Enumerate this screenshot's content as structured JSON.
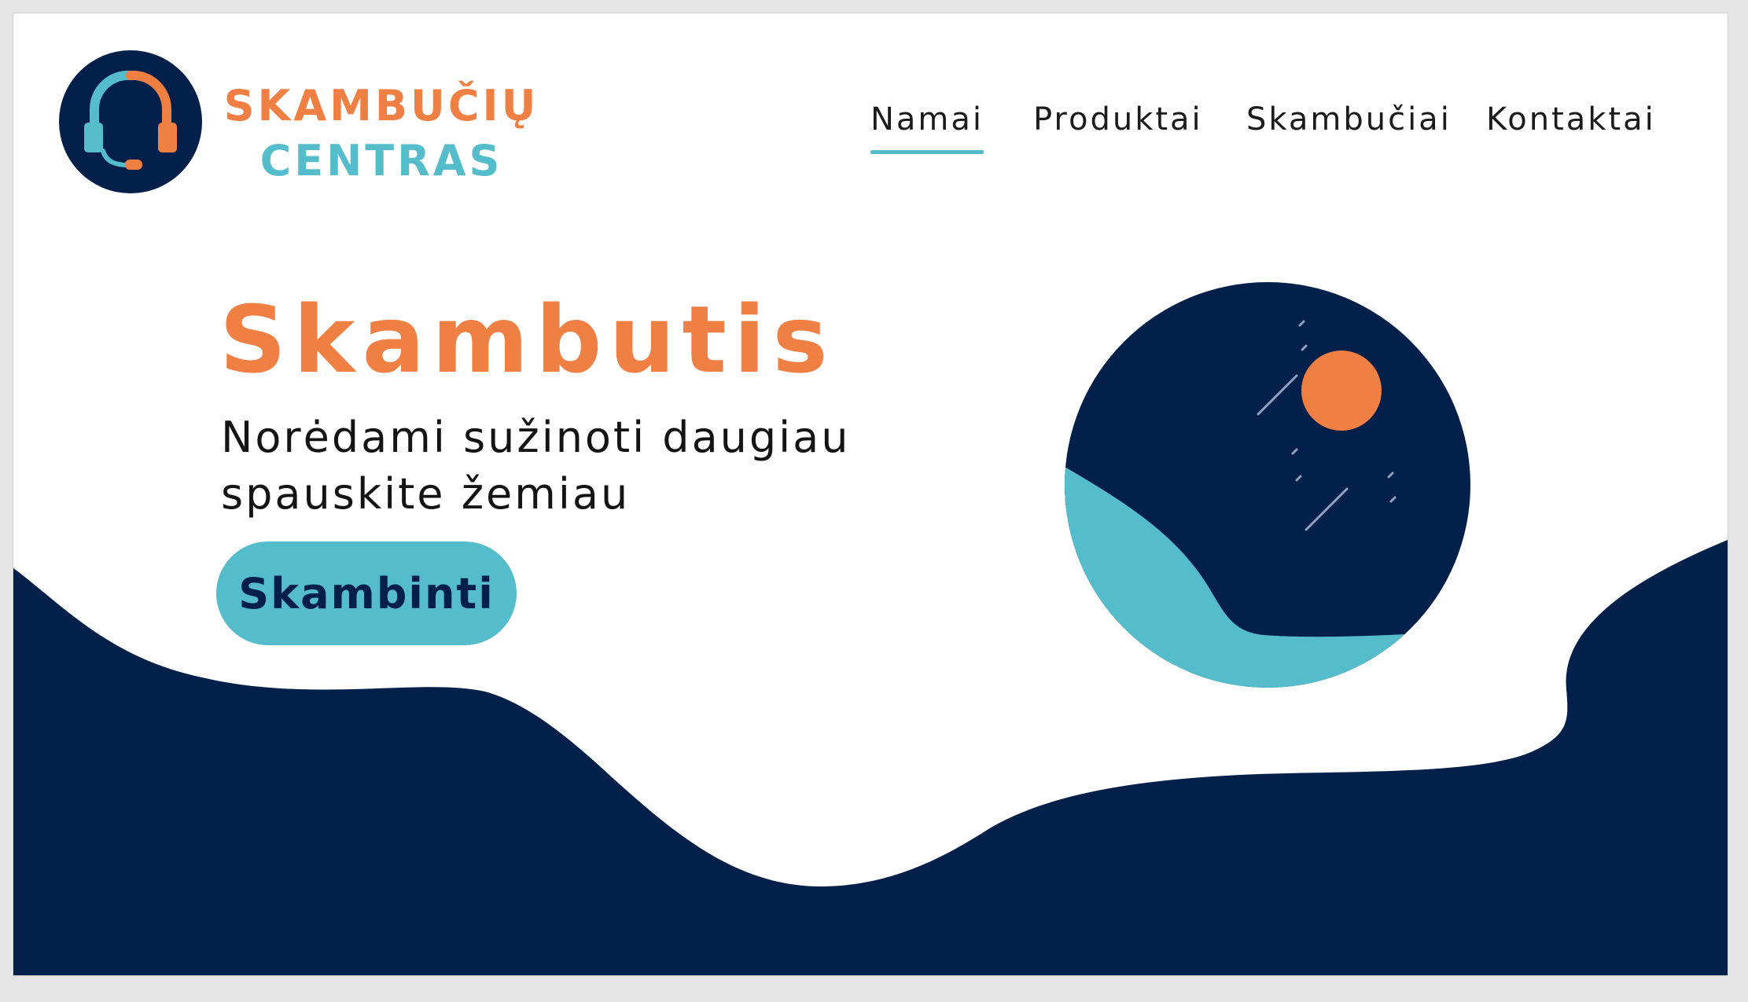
{
  "colors": {
    "navy": "#03204A",
    "orange": "#F07F43",
    "teal": "#55BCCB",
    "white": "#FFFFFF",
    "text_dark": "#141414"
  },
  "brand": {
    "line1": "SKAMBUČIŲ",
    "line2": "CENTRAS",
    "icon": "headset-icon"
  },
  "nav": {
    "items": [
      {
        "label": "Namai",
        "active": true
      },
      {
        "label": "Produktai",
        "active": false
      },
      {
        "label": "Skambučiai",
        "active": false
      },
      {
        "label": "Kontaktai",
        "active": false
      }
    ]
  },
  "hero": {
    "title": "Skambutis",
    "subtitle_line1": "Norėdami sužinoti daugiau",
    "subtitle_line2": "spauskite žemiau",
    "cta_label": "Skambinti"
  },
  "illustration": {
    "name": "night-landscape-illustration",
    "sun": "sun-icon"
  }
}
